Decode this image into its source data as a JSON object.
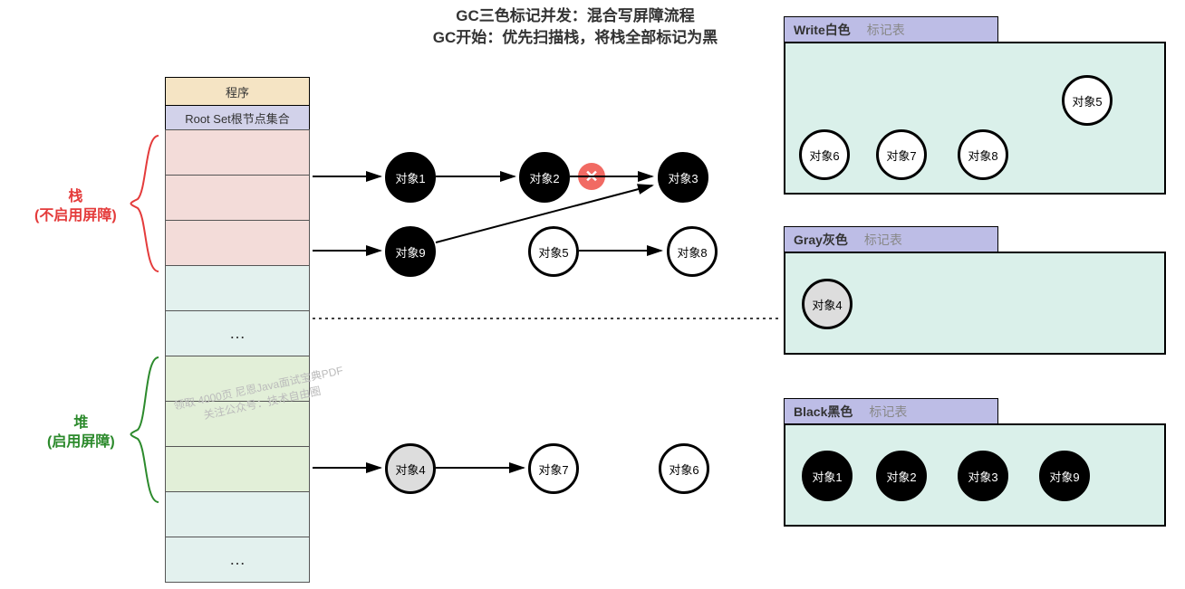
{
  "title": {
    "line1": "GC三色标记并发：混合写屏障流程",
    "line2": "GC开始：优先扫描栈，将栈全部标记为黑"
  },
  "program": {
    "header": "程序",
    "rootset": "Root Set根节点集合",
    "ellipsis": "…"
  },
  "labels": {
    "stack_title": "栈",
    "stack_sub": "(不启用屏障)",
    "heap_title": "堆",
    "heap_sub": "(启用屏障)"
  },
  "objects": {
    "o1": "对象1",
    "o2": "对象2",
    "o3": "对象3",
    "o4": "对象4",
    "o5": "对象5",
    "o6": "对象6",
    "o7": "对象7",
    "o8": "对象8",
    "o9": "对象9"
  },
  "x": "✕",
  "tables": {
    "white": {
      "name": "Write白色",
      "suffix": "标记表"
    },
    "gray": {
      "name": "Gray灰色",
      "suffix": "标记表"
    },
    "black": {
      "name": "Black黑色",
      "suffix": "标记表"
    }
  },
  "watermark": {
    "line1": "领取 4000页 尼恩Java面试宝典PDF",
    "line2": "关注公众号：技术自由圈"
  },
  "colors": {
    "header_bg": "#f5e4c4",
    "rootset_bg": "#d2d2ea",
    "stack_bg": "#f3dcd9",
    "heap_bg": "#e2efd8",
    "mint_bg": "#e3f1ee",
    "panel_bg": "#daf0ea",
    "tab_bg": "#bdbde6",
    "stack_color": "#e43b3b",
    "heap_color": "#2c8a2c"
  }
}
